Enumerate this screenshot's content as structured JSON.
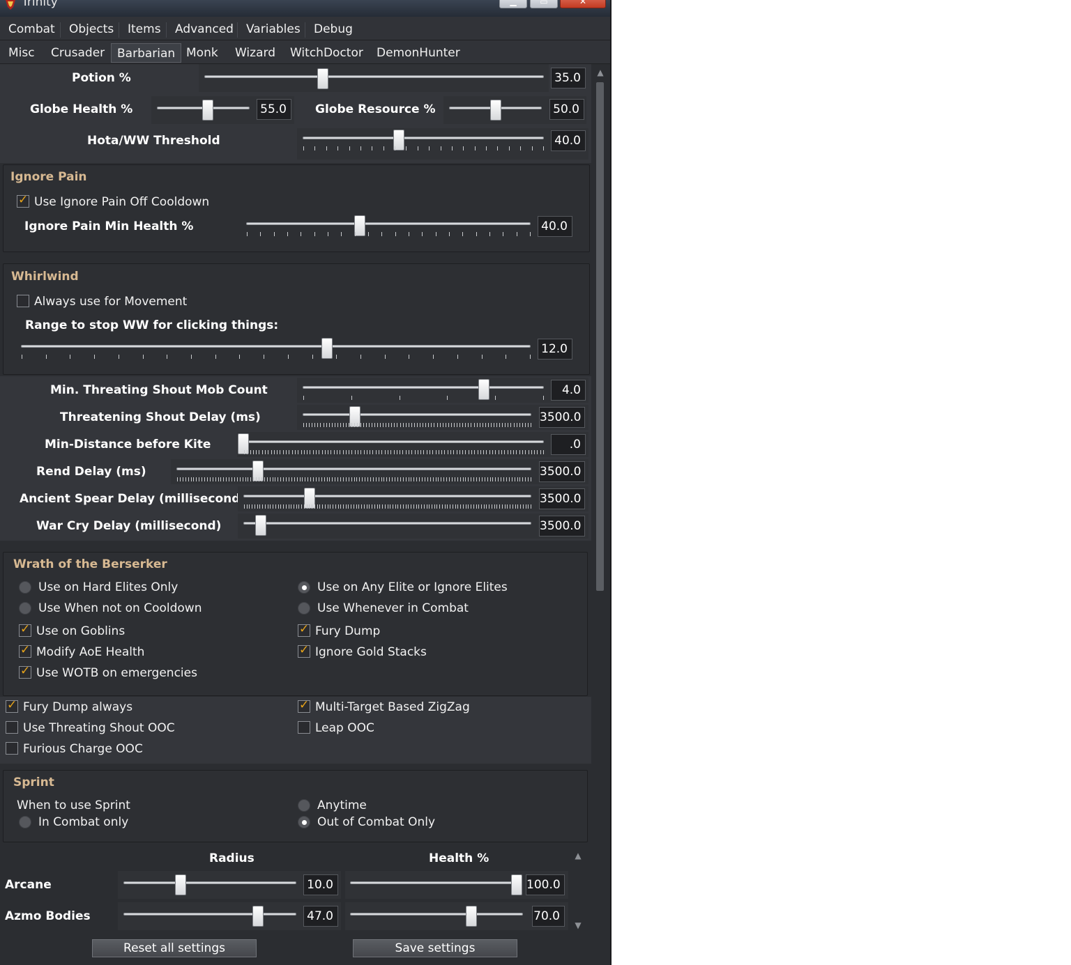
{
  "window": {
    "title": "Trinity"
  },
  "tabs_primary": [
    "Combat",
    "Objects",
    "Items",
    "Advanced",
    "Variables",
    "Debug"
  ],
  "tabs_secondary": [
    "Misc",
    "Crusader",
    "Barbarian",
    "Monk",
    "Wizard",
    "WitchDoctor",
    "DemonHunter"
  ],
  "active_secondary_tab": "Barbarian",
  "top": {
    "potion": {
      "label": "Potion %",
      "value": "35.0",
      "fraction": 0.35
    },
    "globe_health": {
      "label": "Globe Health %",
      "value": "55.0",
      "fraction": 0.55
    },
    "globe_resource": {
      "label": "Globe Resource %",
      "value": "50.0",
      "fraction": 0.5
    },
    "hota": {
      "label": "Hota/WW Threshold",
      "value": "40.0",
      "fraction": 0.4
    }
  },
  "ignore_pain": {
    "title": "Ignore Pain",
    "off_cooldown": {
      "label": "Use Ignore Pain Off Cooldown",
      "checked": true
    },
    "min_health": {
      "label": "Ignore Pain Min Health %",
      "value": "40.0",
      "fraction": 0.4
    }
  },
  "whirlwind": {
    "title": "Whirlwind",
    "movement": {
      "label": "Always use for Movement",
      "checked": false
    },
    "range": {
      "label": "Range to stop WW for clicking things:",
      "value": "12.0",
      "fraction": 0.6
    }
  },
  "delays": {
    "shout_mob": {
      "label": "Min. Threating Shout Mob Count",
      "value": "4.0",
      "fraction": 0.75
    },
    "shout_delay": {
      "label": "Threatening Shout Delay (ms)",
      "value": "3500.0",
      "fraction": 0.23
    },
    "kite": {
      "label": "Min-Distance before Kite",
      "value": ".0",
      "fraction": 0.0
    },
    "rend": {
      "label": "Rend Delay (ms)",
      "value": "3500.0",
      "fraction": 0.23
    },
    "spear": {
      "label": "Ancient Spear Delay (millisecond)",
      "value": "3500.0",
      "fraction": 0.23
    },
    "warcry": {
      "label": "War Cry Delay (millisecond)",
      "value": "3500.0",
      "fraction": 0.06
    }
  },
  "wotb": {
    "title": "Wrath of the Berserker",
    "radios": [
      {
        "label": "Use on Hard Elites Only",
        "selected": false
      },
      {
        "label": "Use on Any Elite or Ignore Elites",
        "selected": true
      },
      {
        "label": "Use When not on Cooldown",
        "selected": false
      },
      {
        "label": "Use Whenever in Combat",
        "selected": false
      }
    ],
    "checks": [
      {
        "label": "Use on Goblins",
        "checked": true
      },
      {
        "label": "Fury Dump",
        "checked": true
      },
      {
        "label": "Modify AoE Health",
        "checked": true
      },
      {
        "label": "Ignore Gold Stacks",
        "checked": true
      },
      {
        "label": "Use WOTB on emergencies",
        "checked": true
      }
    ]
  },
  "misc_checks": [
    {
      "label": "Fury Dump always",
      "checked": true
    },
    {
      "label": "Multi-Target Based ZigZag",
      "checked": true
    },
    {
      "label": "Use Threating Shout OOC",
      "checked": false
    },
    {
      "label": "Leap OOC",
      "checked": false
    },
    {
      "label": "Furious Charge OOC",
      "checked": false
    }
  ],
  "sprint": {
    "title": "Sprint",
    "prompt": "When to use Sprint",
    "radios": [
      {
        "label": "Anytime",
        "selected": false
      },
      {
        "label": "In Combat only",
        "selected": false
      },
      {
        "label": "Out of Combat Only",
        "selected": true
      }
    ]
  },
  "avoidance": {
    "header_radius": "Radius",
    "header_health": "Health %",
    "rows": [
      {
        "name": "Arcane",
        "radius": "10.0",
        "radius_fraction": 0.33,
        "health": "100.0",
        "health_fraction": 1.0
      },
      {
        "name": "Azmo Bodies",
        "radius": "47.0",
        "radius_fraction": 0.78,
        "health": "70.0",
        "health_fraction": 0.7
      }
    ]
  },
  "buttons": {
    "reset": "Reset all settings",
    "save": "Save settings"
  },
  "colors": {
    "background": "#2b2d31",
    "group_title": "#d7b992",
    "check_mark": "#e6a31a"
  }
}
